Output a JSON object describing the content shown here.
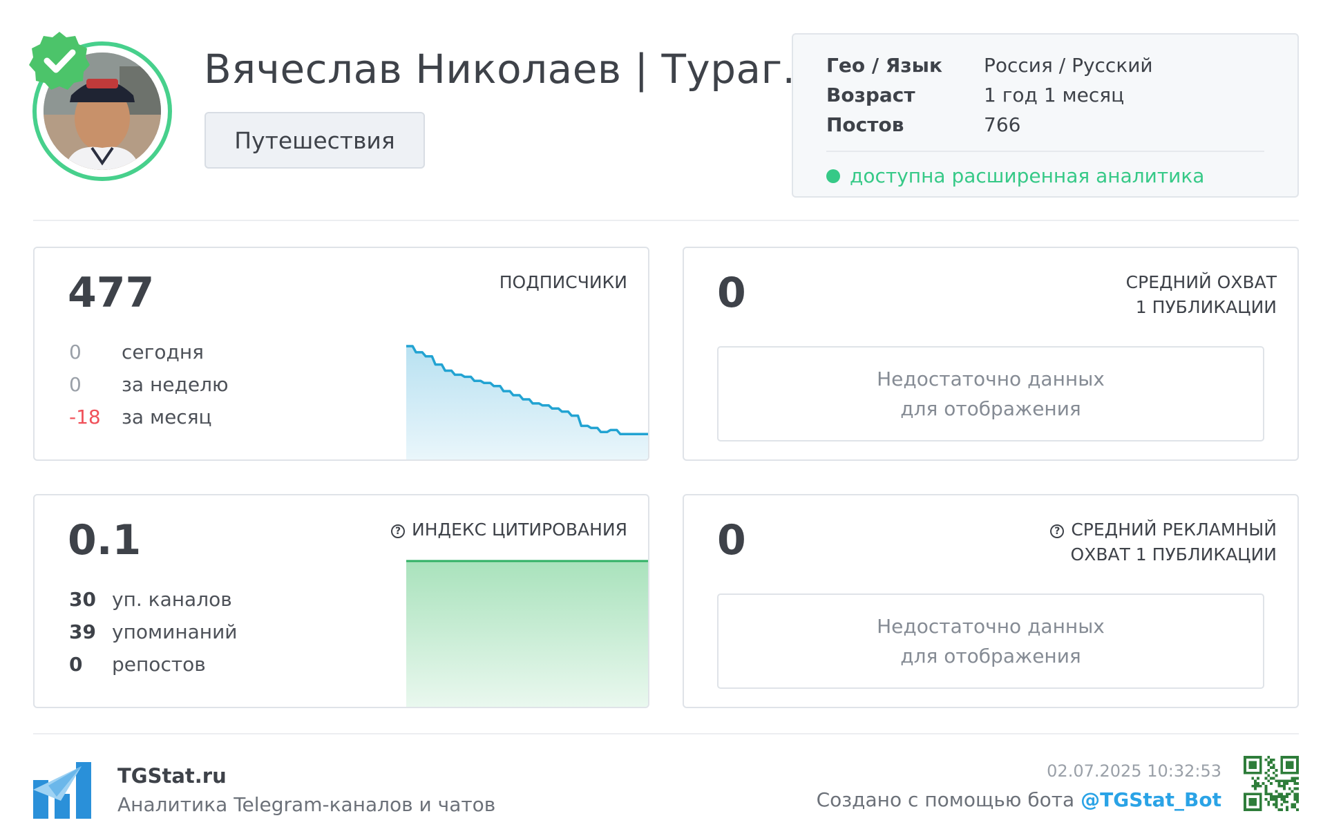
{
  "channel": {
    "title": "Вячеслав Николаев | Тураг...",
    "category": "Путешествия"
  },
  "info": {
    "geo_label": "Гео / Язык",
    "geo_value": "Россия / Русский",
    "age_label": "Возраст",
    "age_value": "1 год 1 месяц",
    "posts_label": "Постов",
    "posts_value": "766",
    "analytics_text": "доступна расширенная аналитика"
  },
  "subscribers": {
    "value": "477",
    "label": "ПОДПИСЧИКИ",
    "today_value": "0",
    "today_label": "сегодня",
    "week_value": "0",
    "week_label": "за неделю",
    "month_value": "-18",
    "month_label": "за месяц"
  },
  "avg_reach": {
    "value": "0",
    "label_line1": "СРЕДНИЙ ОХВАТ",
    "label_line2": "1 ПУБЛИКАЦИИ",
    "nodata_line1": "Недостаточно данных",
    "nodata_line2": "для отображения"
  },
  "citation": {
    "value": "0.1",
    "label": "ИНДЕКС ЦИТИРОВАНИЯ",
    "channels_value": "30",
    "channels_label": "уп. каналов",
    "mentions_value": "39",
    "mentions_label": "упоминаний",
    "reposts_value": "0",
    "reposts_label": "репостов"
  },
  "ad_reach": {
    "value": "0",
    "label_line1": "СРЕДНИЙ РЕКЛАМНЫЙ",
    "label_line2": "ОХВАТ 1 ПУБЛИКАЦИИ",
    "nodata_line1": "Недостаточно данных",
    "nodata_line2": "для отображения"
  },
  "footer": {
    "brand": "TGStat.ru",
    "tagline": "Аналитика Telegram-каналов и чатов",
    "timestamp": "02.07.2025 10:32:53",
    "created_text": "Создано с помощью бота",
    "bot": "@TGStat_Bot"
  },
  "colors": {
    "accent_green": "#36c987",
    "negative_red": "#f0515a",
    "link_blue": "#2aa3e6",
    "sparkline_blue": "#22a3d2"
  },
  "icons": [
    "verified-badge-icon",
    "help-icon",
    "tgstat-logo-icon",
    "qr-code-icon"
  ],
  "sparkline": {
    "relative_levels": [
      1.0,
      0.94,
      0.9,
      0.82,
      0.76,
      0.72,
      0.7,
      0.66,
      0.64,
      0.61,
      0.56,
      0.52,
      0.48,
      0.44,
      0.42,
      0.39,
      0.36,
      0.32,
      0.22,
      0.2,
      0.16,
      0.18,
      0.14,
      0.14,
      0.14,
      0.14
    ]
  }
}
